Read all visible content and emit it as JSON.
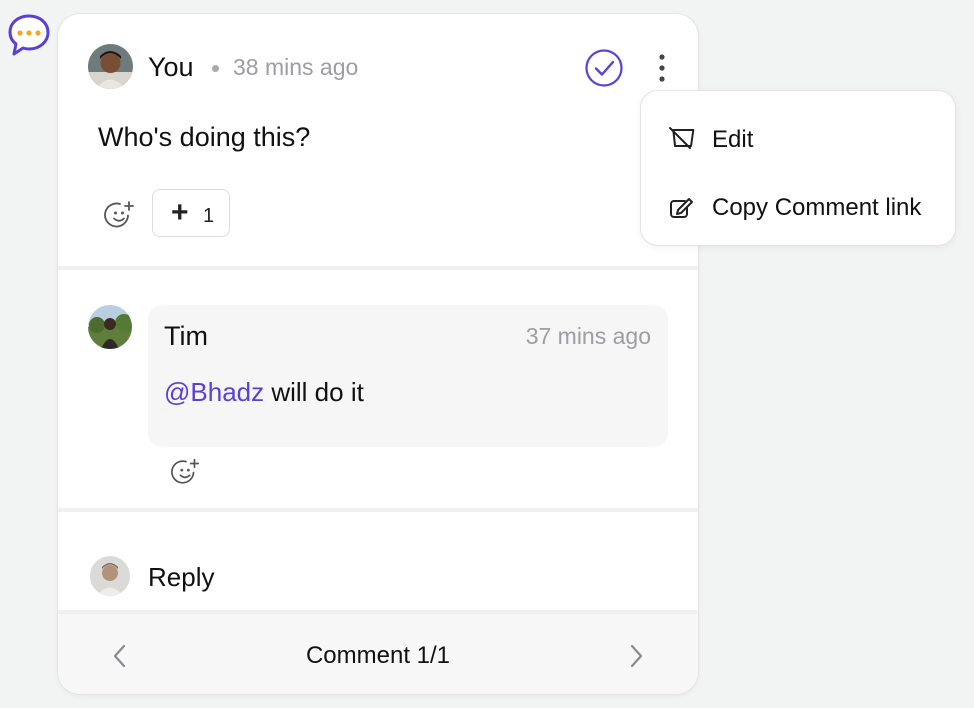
{
  "thread": {
    "main_comment": {
      "author": "You",
      "time": "38 mins ago",
      "text": "Who's doing this?",
      "reaction": {
        "symbol": "+",
        "count": "1"
      }
    },
    "reply": {
      "author": "Tim",
      "time": "37 mins ago",
      "mention": "@Bhadz",
      "text": " will do it"
    },
    "reply_input": {
      "placeholder": "Reply"
    },
    "navigation": {
      "label": "Comment 1/1"
    }
  },
  "context_menu": {
    "items": [
      {
        "label": "Edit",
        "icon": "edit-icon"
      },
      {
        "label": "Copy Comment link",
        "icon": "copy-link-icon"
      }
    ]
  },
  "colors": {
    "accent": "#5b3fd6",
    "bubble_dots": "#f5a623",
    "muted_text": "#9d9da2",
    "background": "#f2f3f3"
  }
}
